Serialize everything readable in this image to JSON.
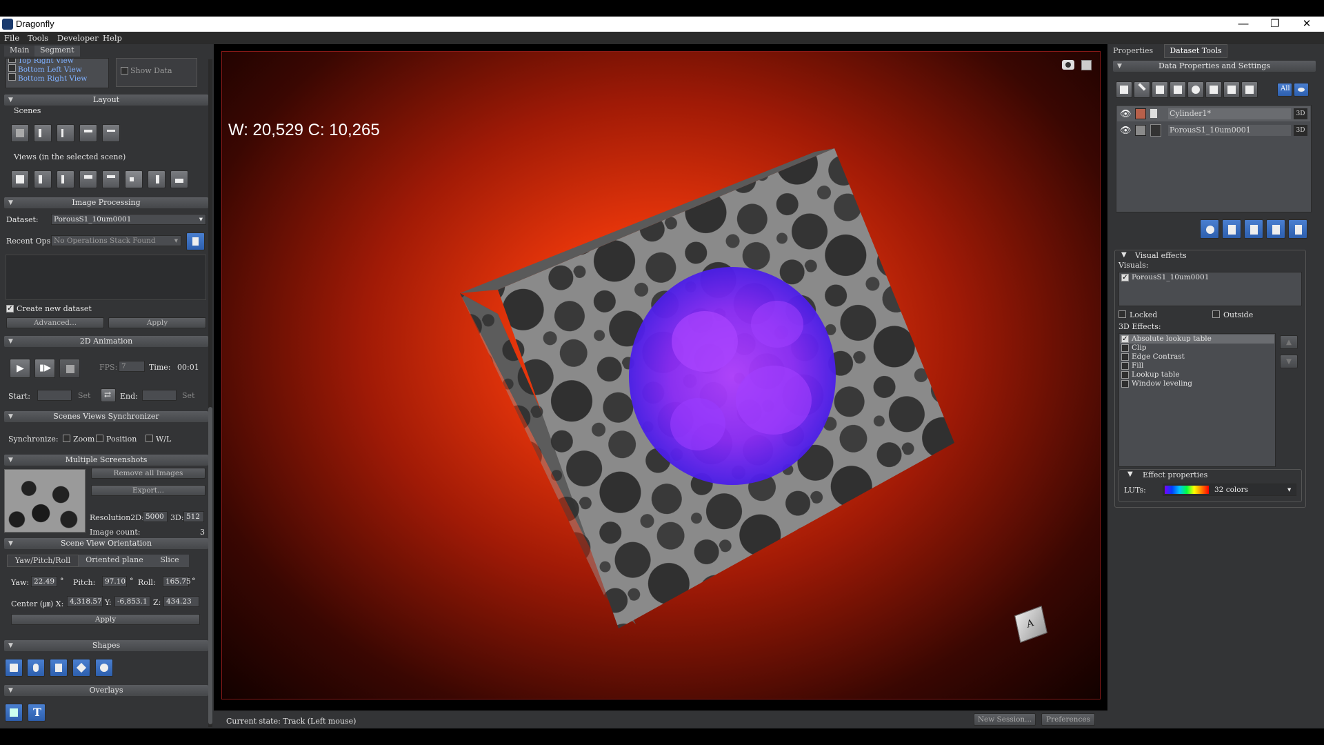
{
  "window": {
    "title": "Dragonfly",
    "minimize": "—",
    "restore": "❐",
    "close": "✕"
  },
  "menu": [
    "File",
    "Tools",
    "Developer",
    "Help"
  ],
  "left_tabs": [
    "Main",
    "Segment"
  ],
  "views_list": [
    "Top Right View",
    "Bottom Left View",
    "Bottom Right View"
  ],
  "show_data_label": "Show Data",
  "layout": {
    "header": "Layout",
    "scenes_label": "Scenes",
    "views_label": "Views (in the selected scene)"
  },
  "image_processing": {
    "header": "Image Processing",
    "dataset_label": "Dataset:",
    "dataset_value": "PorousS1_10um0001",
    "recent_ops_label": "Recent Ops",
    "recent_ops_value": "No Operations Stack Found",
    "create_new_dataset": "Create new dataset",
    "advanced": "Advanced...",
    "apply": "Apply"
  },
  "animation": {
    "header": "2D Animation",
    "fps_label": "FPS:",
    "fps_value": "7",
    "time_label": "Time:",
    "time_value": "00:01",
    "start_label": "Start:",
    "set": "Set",
    "end_label": "End:"
  },
  "sync": {
    "header": "Scenes Views Synchronizer",
    "label": "Synchronize:",
    "zoom": "Zoom",
    "position": "Position",
    "wl": "W/L"
  },
  "screenshots": {
    "header": "Multiple Screenshots",
    "remove_all": "Remove all Images",
    "export": "Export...",
    "resolution_label": "Resolution2D:",
    "res2d": "5000",
    "res3d_label": "3D:",
    "res3d": "512",
    "image_count_label": "Image count:",
    "image_count": "3"
  },
  "orientation": {
    "header": "Scene View Orientation",
    "tabs": [
      "Yaw/Pitch/Roll",
      "Oriented plane",
      "Slice"
    ],
    "yaw_label": "Yaw:",
    "yaw": "22.49",
    "pitch_label": "Pitch:",
    "pitch": "97.10",
    "roll_label": "Roll:",
    "roll": "165.75",
    "deg": "°",
    "center_label": "Center (㎛) X:",
    "x": "4,318.57",
    "y_label": "Y:",
    "y": "-6,853.1",
    "z_label": "Z:",
    "z": "434.23",
    "apply": "Apply"
  },
  "shapes": {
    "header": "Shapes"
  },
  "overlays": {
    "header": "Overlays"
  },
  "viewport": {
    "wl_text": "W: 20,529 C: 10,265",
    "status": "Current state: Track (Left mouse)"
  },
  "bottom_buttons": {
    "new_session": "New Session...",
    "preferences": "Preferences"
  },
  "right_tabs": [
    "Properties",
    "Dataset Tools"
  ],
  "data_props": {
    "header": "Data Properties and Settings",
    "all_btn": "All",
    "datasets": [
      {
        "name": "Cylinder1*",
        "badge": "3D",
        "color": "#b8604a"
      },
      {
        "name": "PorousS1_10um0001",
        "badge": "3D",
        "color": "#8a8a8a"
      }
    ]
  },
  "visual_effects": {
    "header": "Visual effects",
    "visuals_label": "Visuals:",
    "visual_item": "PorousS1_10um0001",
    "locked": "Locked",
    "outside": "Outside",
    "effects_label": "3D Effects:",
    "effects": [
      {
        "name": "Absolute lookup table",
        "checked": true
      },
      {
        "name": "Clip",
        "checked": false
      },
      {
        "name": "Edge Contrast",
        "checked": false
      },
      {
        "name": "Fill",
        "checked": false
      },
      {
        "name": "Lookup table",
        "checked": false
      },
      {
        "name": "Window leveling",
        "checked": false
      }
    ],
    "effect_props_header": "Effect properties",
    "luts_label": "LUTs:",
    "luts_value": "32 colors"
  }
}
